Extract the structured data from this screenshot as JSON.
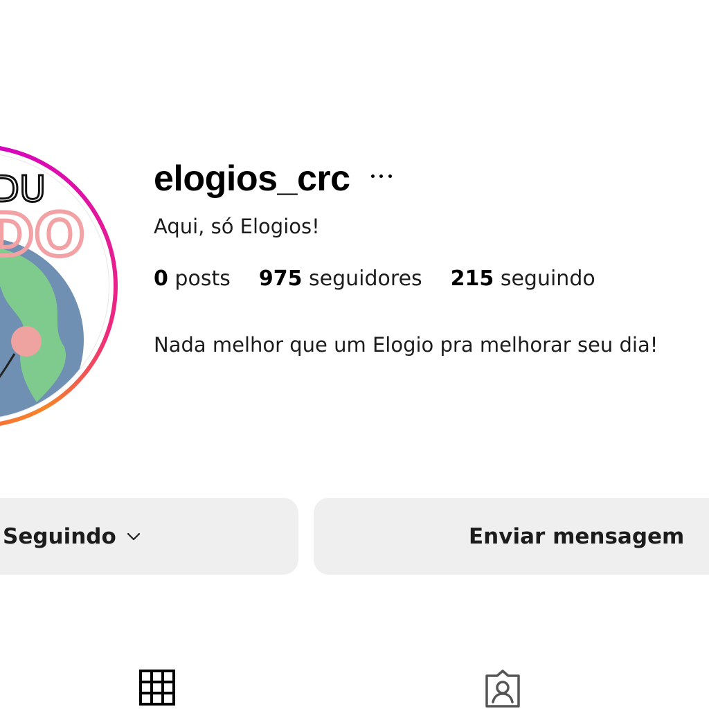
{
  "profile": {
    "username": "elogios_crc",
    "display_name": "Aqui, só Elogios!",
    "bio": "Nada melhor que um Elogio pra melhorar seu dia!",
    "stats": {
      "posts_count": "0",
      "posts_label": "posts",
      "followers_count": "975",
      "followers_label": "seguidores",
      "following_count": "215",
      "following_label": "seguindo"
    },
    "avatar_lettering": {
      "line1": "DU",
      "line2": "DO"
    }
  },
  "actions": {
    "following_label": "Seguindo",
    "message_label": "Enviar mensagem"
  },
  "tabs": [
    {
      "icon": "grid-icon"
    },
    {
      "icon": "tagged-icon"
    }
  ],
  "colors": {
    "button_bg": "#efefef",
    "ring_magenta": "#d300c5",
    "ring_orange": "#f58529",
    "globe_ocean": "#6f8fb3",
    "globe_land": "#7fcb8e",
    "lettering_pink": "#f2a1a5"
  }
}
